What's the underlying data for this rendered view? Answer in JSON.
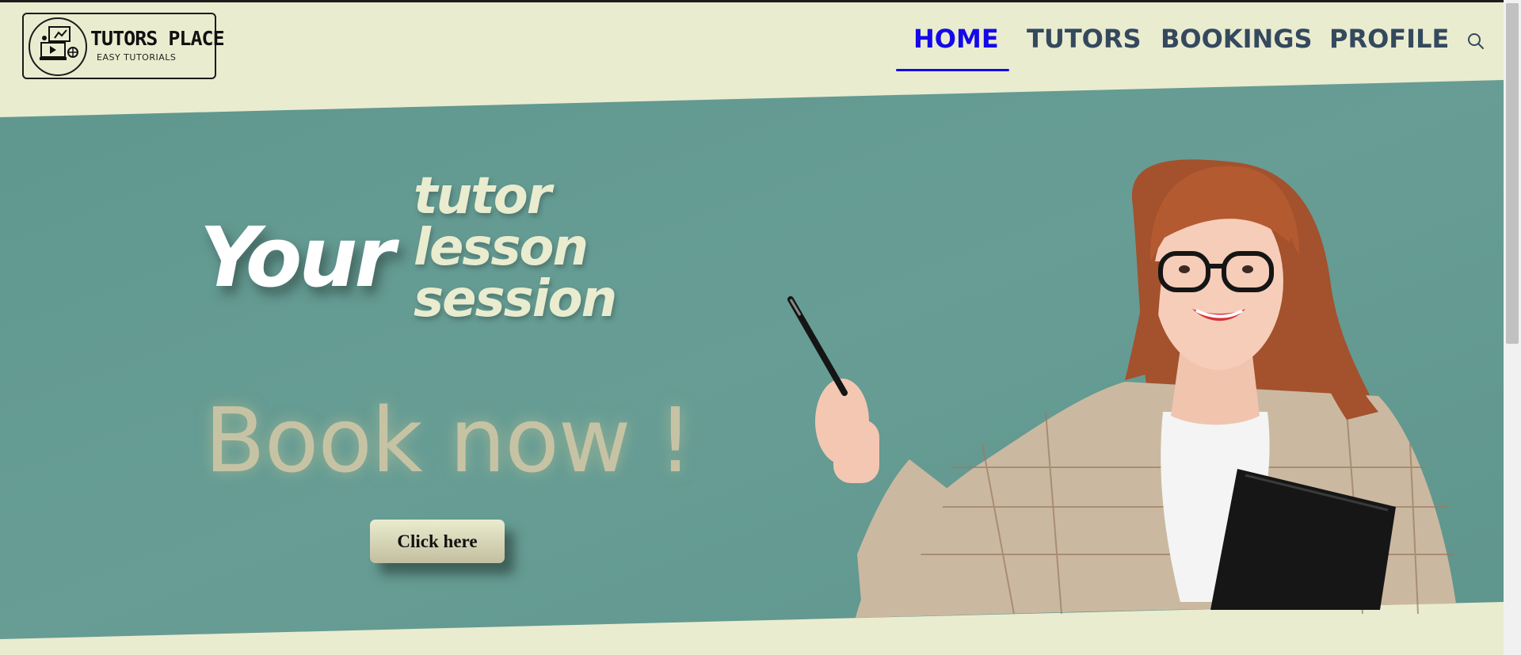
{
  "brand": {
    "title": "TUTORS PLACE",
    "subtitle": "EASY TUTORIALS"
  },
  "nav": {
    "items": [
      {
        "label": "HOME",
        "active": true
      },
      {
        "label": "TUTORS",
        "active": false
      },
      {
        "label": "BOOKINGS",
        "active": false
      },
      {
        "label": "PROFILE",
        "active": false
      }
    ],
    "search_icon": "search-icon"
  },
  "hero": {
    "your": "Your",
    "stack": [
      "tutor",
      "lesson",
      "session"
    ],
    "book_now": "Book now !",
    "cta_label": "Click here"
  },
  "colors": {
    "page_bg": "#eaeccf",
    "hero_bg": "#649a92",
    "nav_text": "#34495e",
    "nav_active": "#1409e8",
    "book_now": "#c6c3a4"
  }
}
